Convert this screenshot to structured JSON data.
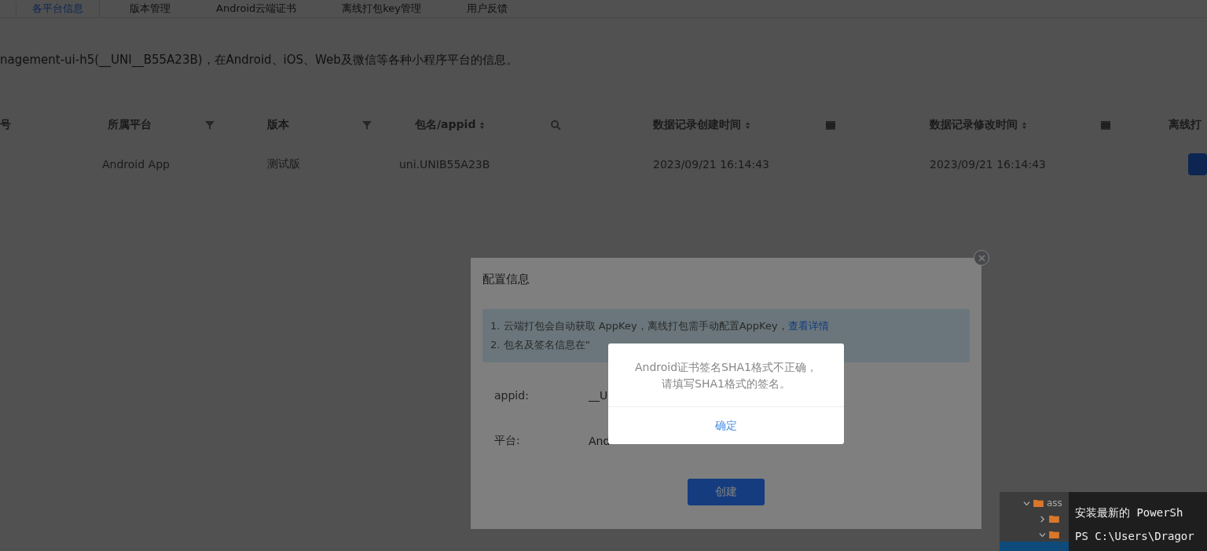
{
  "tabs": [
    {
      "label": "各平台信息",
      "selected": true
    },
    {
      "label": "版本管理",
      "selected": false
    },
    {
      "label": "Android云端证书",
      "selected": false
    },
    {
      "label": "离线打包key管理",
      "selected": false
    },
    {
      "label": "用户反馈",
      "selected": false
    }
  ],
  "description": "nagement-ui-h5(__UNI__B55A23B)，在Android、iOS、Web及微信等各种小程序平台的信息。",
  "table": {
    "columns": [
      {
        "label": "号",
        "sortable": false,
        "kind": "plain"
      },
      {
        "label": "所属平台",
        "sortable": false,
        "kind": "funnel"
      },
      {
        "label": "版本",
        "sortable": false,
        "kind": "funnel"
      },
      {
        "label": "包名/appid",
        "sortable": true,
        "kind": "search"
      },
      {
        "label": "数据记录创建时间",
        "sortable": true,
        "kind": "date"
      },
      {
        "label": "数据记录修改时间",
        "sortable": true,
        "kind": "date"
      },
      {
        "label": "离线打",
        "kind": "plain"
      }
    ],
    "rows": [
      {
        "cells": [
          "",
          "Android App",
          "测试版",
          "uni.UNIB55A23B",
          "2023/09/21 16:14:43",
          "2023/09/21 16:14:43"
        ]
      }
    ]
  },
  "dialog": {
    "title": "配置信息",
    "notice": {
      "line1": "1. 云端打包会自动获取 AppKey，离线打包需手动配置AppKey，",
      "link": "查看详情",
      "line2": "2. 包名及签名信息在“"
    },
    "fields": [
      {
        "label": "appid:",
        "value": "__U"
      },
      {
        "label": "平台:",
        "value": "And"
      }
    ],
    "button": "创建"
  },
  "alert": {
    "message": [
      "Android证书签名SHA1格式不正确，",
      "请填写SHA1格式的签名。"
    ],
    "button": "确定"
  },
  "terminal": {
    "tree": [
      {
        "name": "ass",
        "expanded": true
      },
      {
        "expanded": false
      },
      {
        "expanded": true
      }
    ],
    "lines": [
      "安装最新的 PowerSh",
      "PS C:\\Users\\Dragor"
    ]
  }
}
